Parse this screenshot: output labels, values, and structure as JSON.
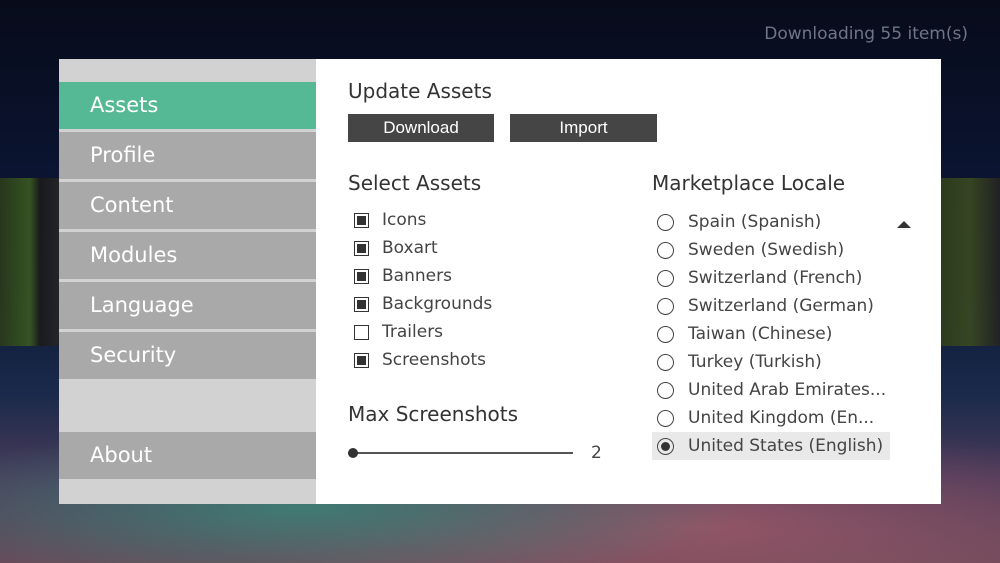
{
  "status": "Downloading 55 item(s)",
  "sidebar": {
    "items": [
      {
        "label": "Assets",
        "active": true
      },
      {
        "label": "Profile"
      },
      {
        "label": "Content"
      },
      {
        "label": "Modules"
      },
      {
        "label": "Language"
      },
      {
        "label": "Security"
      }
    ],
    "about": "About"
  },
  "update": {
    "title": "Update Assets",
    "download": "Download",
    "import": "Import"
  },
  "select": {
    "title": "Select Assets",
    "items": [
      {
        "label": "Icons",
        "checked": true
      },
      {
        "label": "Boxart",
        "checked": true
      },
      {
        "label": "Banners",
        "checked": true
      },
      {
        "label": "Backgrounds",
        "checked": true
      },
      {
        "label": "Trailers",
        "checked": false
      },
      {
        "label": "Screenshots",
        "checked": true
      }
    ]
  },
  "max": {
    "title": "Max Screenshots",
    "value": "2"
  },
  "locale": {
    "title": "Marketplace Locale",
    "options": [
      {
        "label": "Spain (Spanish)"
      },
      {
        "label": "Sweden (Swedish)"
      },
      {
        "label": "Switzerland (French)"
      },
      {
        "label": "Switzerland (German)"
      },
      {
        "label": "Taiwan (Chinese)"
      },
      {
        "label": "Turkey (Turkish)"
      },
      {
        "label": "United Arab Emirates..."
      },
      {
        "label": "United Kingdom (En..."
      },
      {
        "label": "United States (English)",
        "selected": true
      }
    ]
  },
  "colors": {
    "accent": "#54b994",
    "button": "#454545"
  }
}
